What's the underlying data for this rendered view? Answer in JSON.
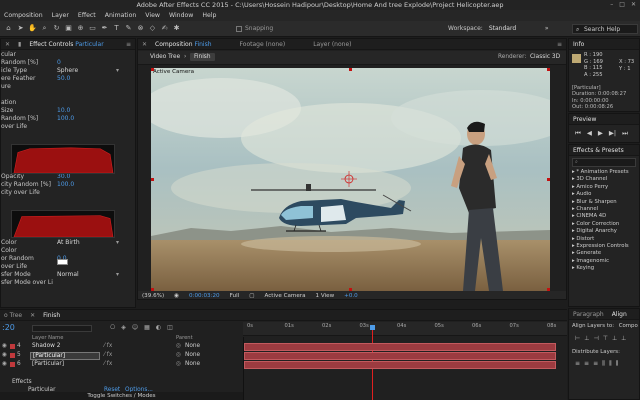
{
  "app": {
    "title": "Adobe After Effects CC 2015 - C:\\Users\\Hossein Hadipour\\Desktop\\Home And tree Explode\\Project Helicopter.aep"
  },
  "menu": [
    "Composition",
    "Layer",
    "Effect",
    "Animation",
    "View",
    "Window",
    "Help"
  ],
  "toolbar": {
    "snapping": "Snapping",
    "workspace_label": "Workspace:",
    "workspace_value": "Standard",
    "search_help": "Search Help"
  },
  "effect_controls": {
    "tab_label": "Effect Controls",
    "tab_target": "Particular",
    "rows": [
      {
        "label": "cular",
        "value": ""
      },
      {
        "label": "Random [%]",
        "value": "0"
      },
      {
        "label": "icle Type",
        "value": "Sphere",
        "dropdown": true
      },
      {
        "label": "ere Feather",
        "value": "50.0"
      },
      {
        "label": "ure",
        "value": ""
      },
      {
        "label": "",
        "value": ""
      },
      {
        "label": "ation",
        "value": ""
      },
      {
        "label": "Size",
        "value": "10.0"
      },
      {
        "label": "Random [%]",
        "value": "100.0"
      },
      {
        "label": "over Life",
        "value": ""
      },
      {
        "label": "Opacity",
        "value": "30.0"
      },
      {
        "label": "city Random [%]",
        "value": "100.0"
      },
      {
        "label": "city over Life",
        "value": ""
      },
      {
        "label": "Color",
        "value": "At Birth",
        "dropdown": true
      },
      {
        "label": "Color",
        "value": ""
      },
      {
        "label": "or Random",
        "value": "0.0"
      },
      {
        "label": "over Life",
        "value": ""
      },
      {
        "label": "sfer Mode",
        "value": "Normal",
        "dropdown": true
      },
      {
        "label": "sfer Mode over Li",
        "value": ""
      }
    ]
  },
  "composition": {
    "tab_label": "Composition",
    "tab_target": "Finish",
    "other_tabs": [
      "Footage (none)",
      "Layer (none)"
    ],
    "video_tree": "Video Tree",
    "finish_chip": "Finish",
    "renderer_label": "Renderer:",
    "renderer_value": "Classic 3D",
    "active_camera_label": "Active Camera",
    "footer": {
      "zoom": "(39.6%)",
      "timecode": "0:00:03:20",
      "quality": "Full",
      "view": "Active Camera",
      "views": "1 View",
      "exposure": "+0.0"
    }
  },
  "info": {
    "tab_label": "Info",
    "r": "R : 190",
    "g": "G : 169",
    "b": "B : 115",
    "a": "A : 255",
    "x": "X : 73",
    "y": "Y : 1",
    "layer": "[Particular]",
    "duration": "Duration: 0:00:08:27",
    "in": "In: 0:00:00:00",
    "out": "Out: 0:00:08:26"
  },
  "preview": {
    "tab_label": "Preview"
  },
  "presets": {
    "tab_label": "Effects & Presets",
    "items": [
      "* Animation Presets",
      "3D Channel",
      "Amico Perry",
      "Audio",
      "Blur & Sharpen",
      "Channel",
      "CINEMA 4D",
      "Color Correction",
      "Digital Anarchy",
      "Distort",
      "Expression Controls",
      "Generate",
      "Imagenomic",
      "Keying"
    ]
  },
  "paragraph": {
    "tabs": [
      "Paragraph",
      "Align"
    ],
    "align_to_label": "Align Layers to:",
    "align_to_value": "Compo",
    "distribute_label": "Distribute Layers:"
  },
  "timeline": {
    "timecode": ":20",
    "tab_tree": "o Tree",
    "tab_finish": "Finish",
    "col_layer_name": "Layer Name",
    "col_parent": "Parent",
    "rows": [
      {
        "num": "4",
        "name": "Shadow 2",
        "parent": "None",
        "selected": false
      },
      {
        "num": "5",
        "name": "[Particular]",
        "parent": "None",
        "selected": true
      },
      {
        "num": "6",
        "name": "[Particular]",
        "parent": "None",
        "selected": false
      }
    ],
    "effects_label": "Effects",
    "sub_effect": "Particular",
    "reset": "Reset",
    "options": "Options...",
    "toggle": "Toggle Switches / Modes",
    "ruler_ticks": [
      "0s",
      "01s",
      "02s",
      "03s",
      "04s",
      "05s",
      "06s",
      "07s",
      "08s"
    ]
  },
  "colors": {
    "accent_blue": "#4d9be8",
    "layer_bar": "#9c3b40",
    "playhead": "#e02020"
  }
}
